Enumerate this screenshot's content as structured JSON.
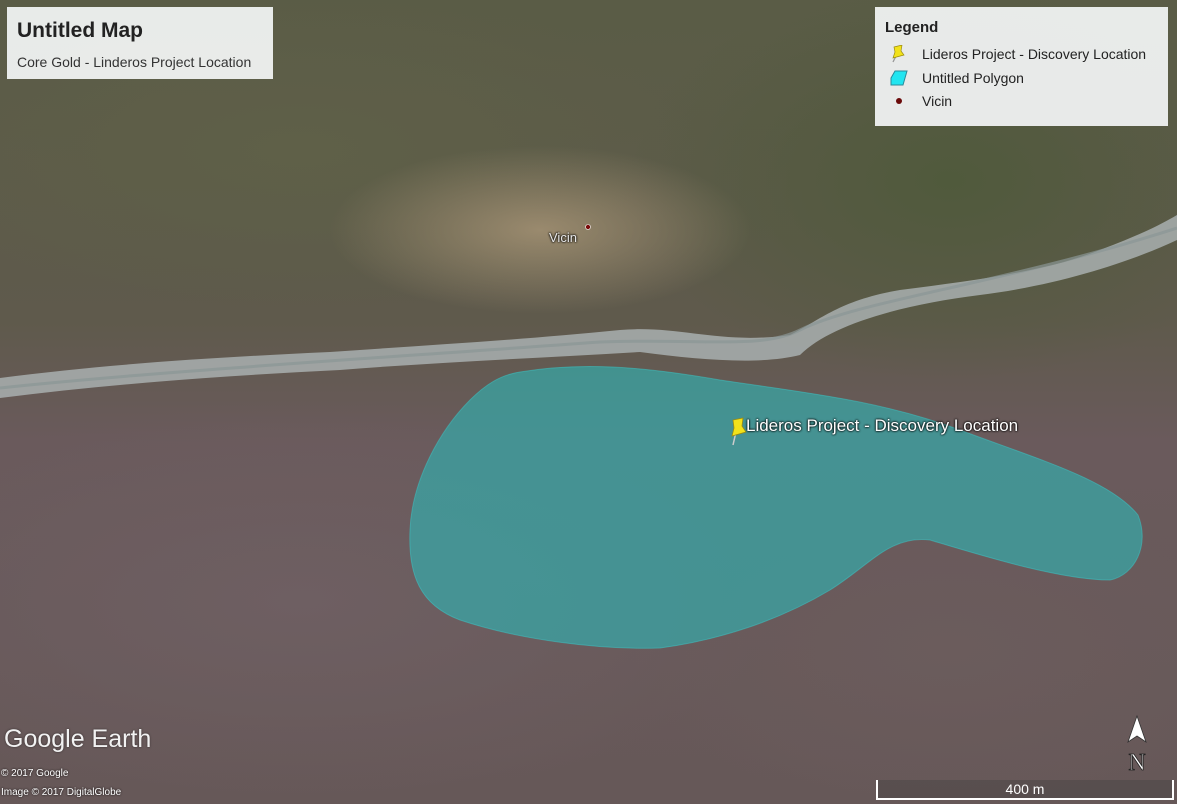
{
  "title": {
    "main": "Untitled Map",
    "subtitle": "Core Gold - Linderos Project Location"
  },
  "legend": {
    "heading": "Legend",
    "items": [
      {
        "icon": "yellow-pushpin-icon",
        "label": "Lideros Project - Discovery Location"
      },
      {
        "icon": "cyan-polygon-icon",
        "label": "Untitled Polygon"
      },
      {
        "icon": "dark-red-dot-icon",
        "label": "Vicin"
      }
    ]
  },
  "map_labels": {
    "vicin": "Vicin",
    "discovery": "Lideros Project - Discovery Location"
  },
  "branding": {
    "logo": "Google Earth",
    "copyright": "© 2017 Google",
    "imagery": "Image © 2017 DigitalGlobe"
  },
  "scale_bar": {
    "label": "400 m"
  },
  "compass": {
    "label": "N"
  },
  "colors": {
    "polygon": "#2fb5b5",
    "pin": "#f2e21a",
    "vicin_dot": "#7a0a0a"
  }
}
